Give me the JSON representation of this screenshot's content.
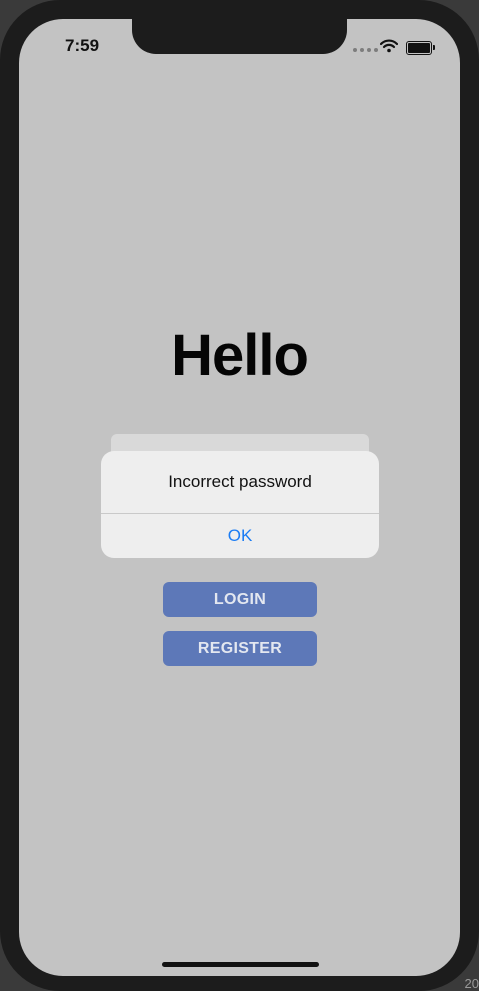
{
  "status_bar": {
    "time": "7:59"
  },
  "icons": {
    "wifi": "wifi-icon",
    "battery": "battery-icon",
    "signal": "signal-dots-icon"
  },
  "main": {
    "title": "Hello",
    "buttons": {
      "login": "LOGIN",
      "register": "REGISTER"
    }
  },
  "alert": {
    "message": "Incorrect password",
    "ok": "OK"
  },
  "corner_text": "20",
  "colors": {
    "background": "#c3c3c3",
    "button": "#5d78b8",
    "alert_action": "#1b7cf4",
    "frame": "#1c1c1c"
  }
}
